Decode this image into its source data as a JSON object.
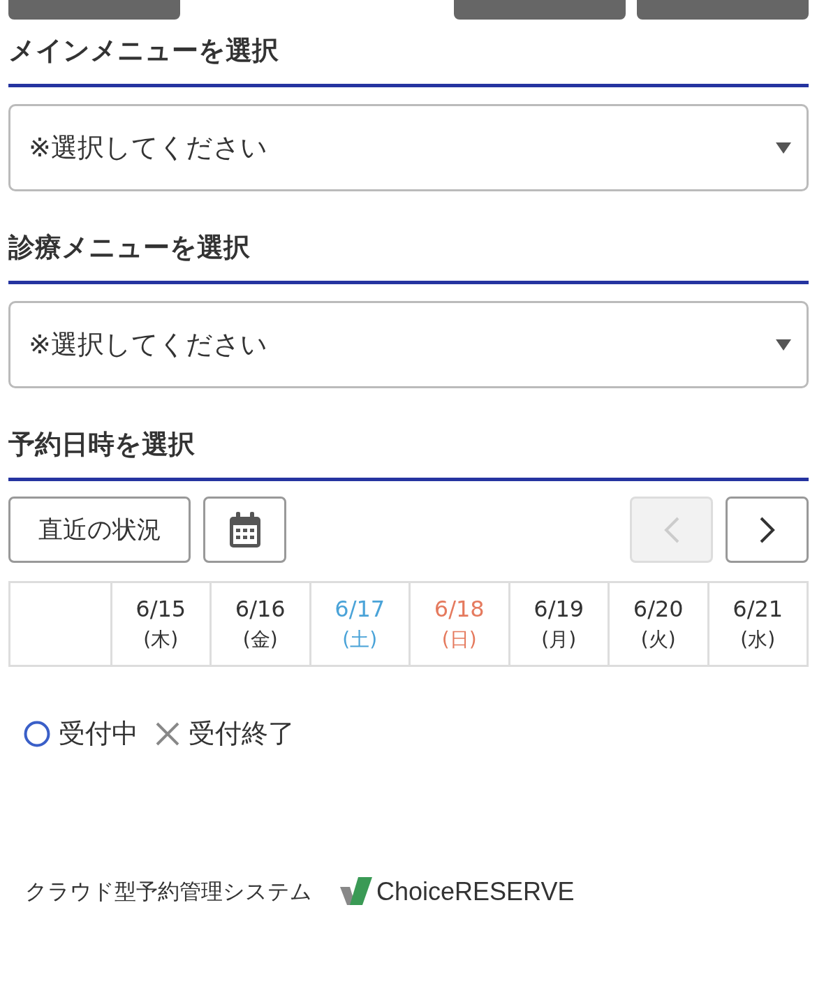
{
  "sections": [
    {
      "heading": "メインメニューを選択",
      "select": {
        "placeholder": "※選択してください"
      }
    },
    {
      "heading": "診療メニューを選択",
      "select": {
        "placeholder": "※選択してください"
      }
    },
    {
      "heading": "予約日時を選択"
    }
  ],
  "toolbar": {
    "recent_button": "直近の状況",
    "prev": {
      "disabled": true
    },
    "next": {
      "disabled": false
    }
  },
  "dates": [
    {
      "date": "6/15",
      "weekday": "(木)",
      "color": "#333333"
    },
    {
      "date": "6/16",
      "weekday": "(金)",
      "color": "#333333"
    },
    {
      "date": "6/17",
      "weekday": "(土)",
      "color": "#4aa3d8"
    },
    {
      "date": "6/18",
      "weekday": "(日)",
      "color": "#e57a5e"
    },
    {
      "date": "6/19",
      "weekday": "(月)",
      "color": "#333333"
    },
    {
      "date": "6/20",
      "weekday": "(火)",
      "color": "#333333"
    },
    {
      "date": "6/21",
      "weekday": "(水)",
      "color": "#333333"
    }
  ],
  "legend": [
    {
      "kind": "open",
      "label": "受付中"
    },
    {
      "kind": "closed",
      "label": "受付終了"
    }
  ],
  "footer": {
    "text": "クラウド型予約管理システム",
    "logo": "ChoiceRESERVE"
  }
}
